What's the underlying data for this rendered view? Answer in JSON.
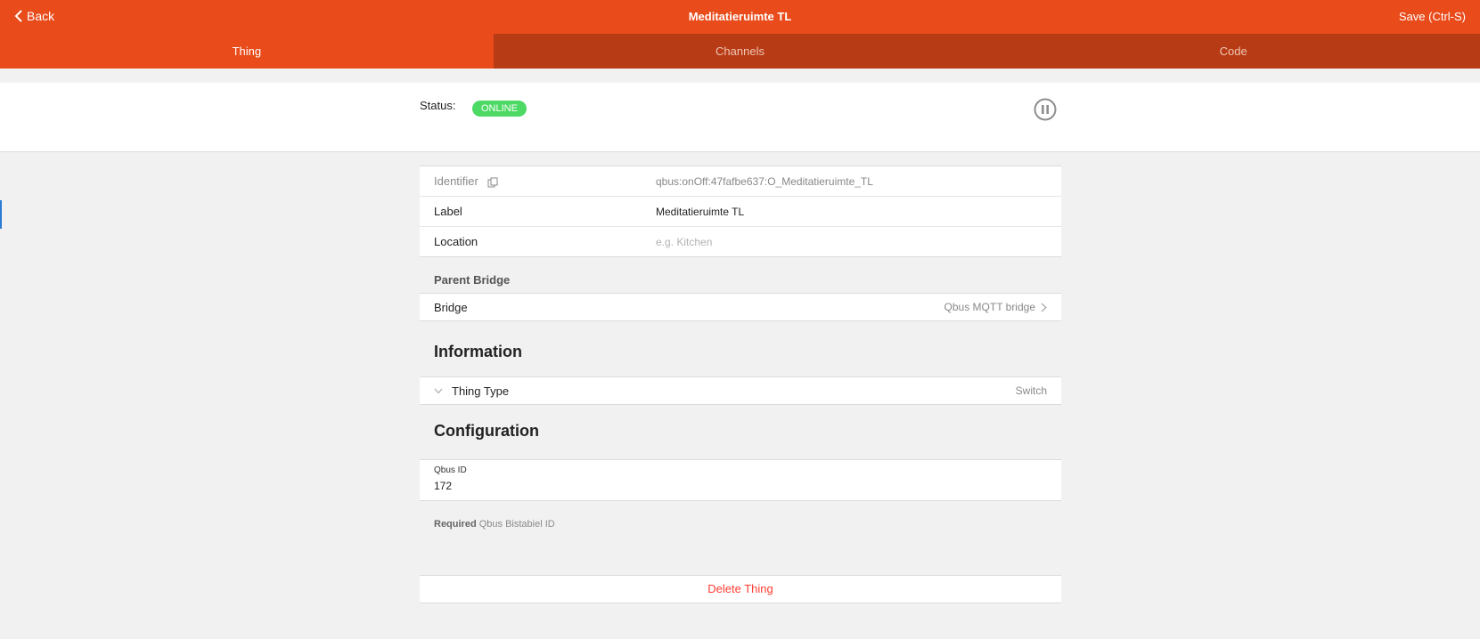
{
  "header": {
    "back_label": "Back",
    "title": "Meditatieruimte TL",
    "save_label": "Save (Ctrl-S)"
  },
  "tabs": [
    {
      "label": "Thing",
      "active": true
    },
    {
      "label": "Channels",
      "active": false
    },
    {
      "label": "Code",
      "active": false
    }
  ],
  "status": {
    "label": "Status:",
    "badge": "ONLINE",
    "badge_color": "#4cd964",
    "pause_icon": "pause-circle-icon"
  },
  "properties": {
    "identifier_label": "Identifier",
    "identifier_value": "qbus:onOff:47fafbe637:O_Meditatieruimte_TL",
    "label_label": "Label",
    "label_value": "Meditatieruimte TL",
    "location_label": "Location",
    "location_placeholder": "e.g. Kitchen"
  },
  "parent_bridge": {
    "section_title": "Parent Bridge",
    "bridge_label": "Bridge",
    "bridge_value": "Qbus MQTT bridge"
  },
  "information": {
    "title": "Information",
    "thing_type_label": "Thing Type",
    "thing_type_value": "Switch"
  },
  "configuration": {
    "title": "Configuration",
    "field_label": "Qbus ID",
    "field_value": "172",
    "hint_required": "Required",
    "hint_text": "Qbus Bistabiel ID"
  },
  "actions": {
    "delete_label": "Delete Thing"
  },
  "colors": {
    "accent": "#e94b1b",
    "tab_inactive": "#b73b14",
    "danger": "#ff3b30"
  }
}
